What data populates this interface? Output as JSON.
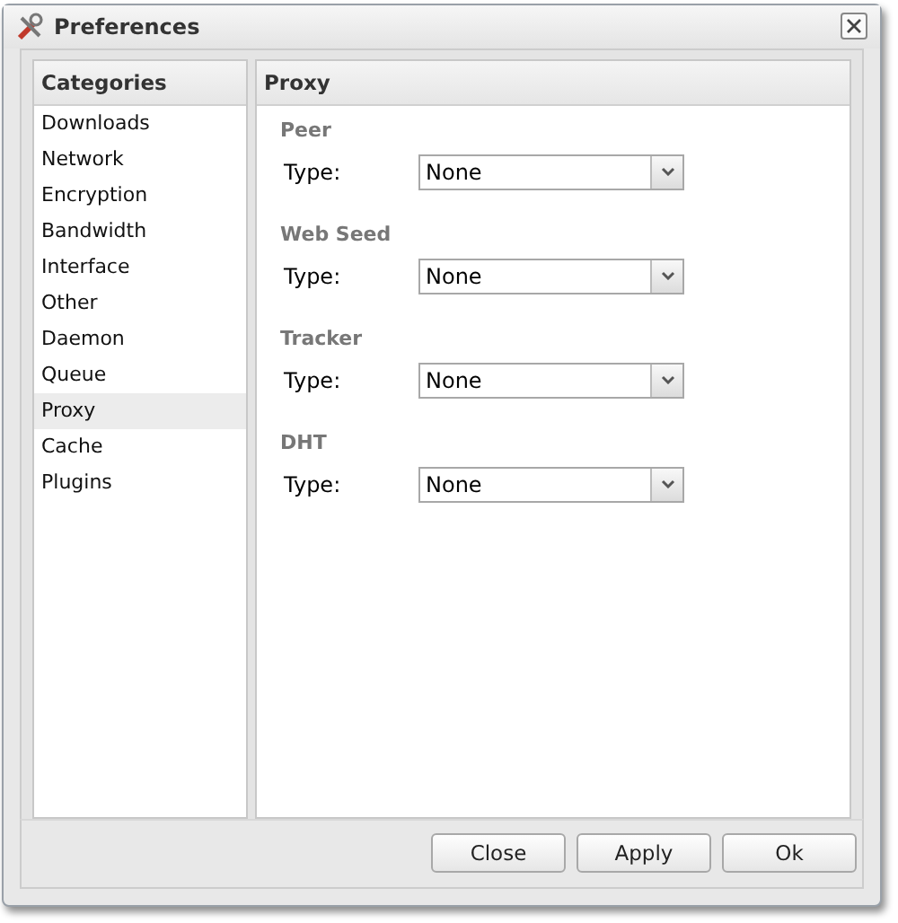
{
  "window": {
    "title": "Preferences"
  },
  "sidebar": {
    "title": "Categories",
    "items": [
      {
        "label": "Downloads",
        "selected": false
      },
      {
        "label": "Network",
        "selected": false
      },
      {
        "label": "Encryption",
        "selected": false
      },
      {
        "label": "Bandwidth",
        "selected": false
      },
      {
        "label": "Interface",
        "selected": false
      },
      {
        "label": "Other",
        "selected": false
      },
      {
        "label": "Daemon",
        "selected": false
      },
      {
        "label": "Queue",
        "selected": false
      },
      {
        "label": "Proxy",
        "selected": true
      },
      {
        "label": "Cache",
        "selected": false
      },
      {
        "label": "Plugins",
        "selected": false
      }
    ]
  },
  "panel": {
    "title": "Proxy",
    "sections": [
      {
        "title": "Peer",
        "label": "Type:",
        "value": "None"
      },
      {
        "title": "Web Seed",
        "label": "Type:",
        "value": "None"
      },
      {
        "title": "Tracker",
        "label": "Type:",
        "value": "None"
      },
      {
        "title": "DHT",
        "label": "Type:",
        "value": "None"
      }
    ]
  },
  "buttons": [
    "Close",
    "Apply",
    "Ok"
  ]
}
